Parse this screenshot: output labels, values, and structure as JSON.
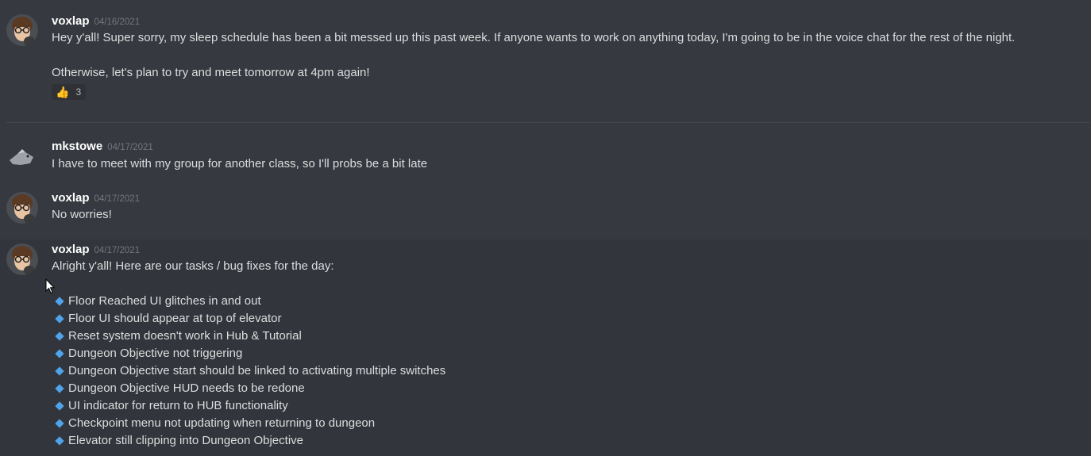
{
  "messages": [
    {
      "username": "voxlap",
      "timestamp": "04/16/2021",
      "lines": [
        "Hey y'all! Super sorry, my sleep schedule has been a bit messed up this past week. If anyone wants to work on anything today, I'm going to be in the voice chat for the rest of the night.",
        "Otherwise, let's plan to try and meet tomorrow at 4pm again!"
      ],
      "reaction": {
        "emoji": "👍",
        "count": "3"
      }
    },
    {
      "username": "mkstowe",
      "timestamp": "04/17/2021",
      "lines": [
        "I have to meet with my group for another class, so I'll probs be a bit late"
      ]
    },
    {
      "username": "voxlap",
      "timestamp": "04/17/2021",
      "lines": [
        "No worries!"
      ]
    },
    {
      "username": "voxlap",
      "timestamp": "04/17/2021",
      "lines": [
        "Alright y'all! Here are our tasks / bug fixes for the day:"
      ],
      "tasks": [
        "Floor Reached UI glitches in and out",
        "Floor UI should appear at top of elevator",
        "Reset system doesn't work in Hub & Tutorial",
        "Dungeon Objective not triggering",
        "Dungeon Objective start should be linked to activating multiple switches",
        "Dungeon Objective HUD needs to be redone",
        "UI indicator for return to HUB functionality",
        "Checkpoint menu not updating when returning to dungeon",
        "Elevator still clipping into Dungeon Objective"
      ]
    }
  ],
  "colors": {
    "background": "#36393f",
    "hover_background": "#32353b",
    "username": "#ffffff",
    "timestamp": "#72767d",
    "text": "#dcddde",
    "bullet": "#4fa3ea"
  },
  "icons": {
    "bullet": "blue-diamond-icon",
    "reaction": "thumbs-up-icon",
    "cursor": "mouse-pointer-icon"
  }
}
